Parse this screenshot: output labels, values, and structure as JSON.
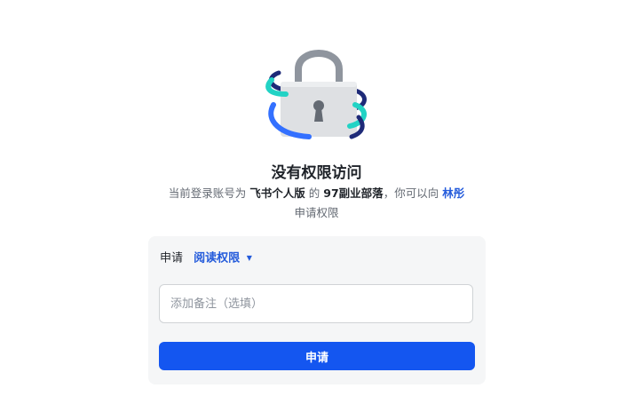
{
  "icons": {
    "illustration": "padlock-icon"
  },
  "colors": {
    "primary": "#1456f0",
    "link": "#245bdb",
    "ring_teal": "#22d3c5",
    "ring_blue": "#3370ff",
    "ring_navy": "#1e2a78"
  },
  "header": {
    "title": "没有权限访问"
  },
  "description": {
    "prefix": "当前登录账号为",
    "account_name": "飞书个人版",
    "connector": "的",
    "org_name": "97副业部落",
    "middle": "，你可以向",
    "owner_name": "林彤",
    "suffix": "申请权限"
  },
  "request_form": {
    "apply_label": "申请",
    "permission_value": "阅读权限",
    "remark_placeholder": "添加备注（选填）",
    "remark_value": "",
    "submit_label": "申请"
  }
}
